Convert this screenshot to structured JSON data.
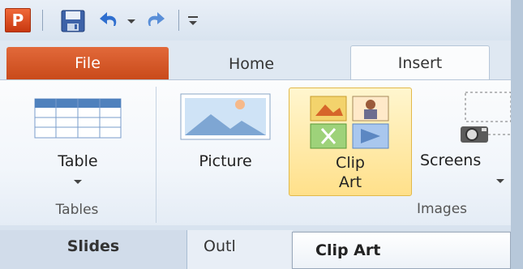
{
  "quick_access": {
    "app_logo_letter": "P",
    "icons": [
      "powerpoint-logo",
      "save-icon",
      "undo-icon",
      "redo-icon",
      "customize-toolbar-icon"
    ]
  },
  "tabs": [
    {
      "label": "File",
      "active": false
    },
    {
      "label": "Home",
      "active": false
    },
    {
      "label": "Insert",
      "active": true
    }
  ],
  "ribbon": {
    "groups": [
      {
        "name": "Tables",
        "buttons": [
          {
            "label": "Table",
            "icon": "table-icon",
            "has_dropdown": true
          }
        ]
      },
      {
        "name": "Images",
        "buttons": [
          {
            "label": "Picture",
            "icon": "picture-icon",
            "has_dropdown": false
          },
          {
            "label_line1": "Clip",
            "label_line2": "Art",
            "icon": "clip-art-icon",
            "has_dropdown": false,
            "highlighted": true
          },
          {
            "label": "Screens",
            "icon": "screenshot-icon",
            "has_dropdown": true
          }
        ]
      }
    ]
  },
  "panel_tabs": [
    {
      "label": "Slides",
      "active": true
    },
    {
      "label": "Outl",
      "active": false
    }
  ],
  "tooltip": {
    "title": "Clip Art"
  },
  "colors": {
    "file_tab": "#d85a2a",
    "highlight": "#ffe08a",
    "ribbon_bg": "#f2f6fb"
  }
}
